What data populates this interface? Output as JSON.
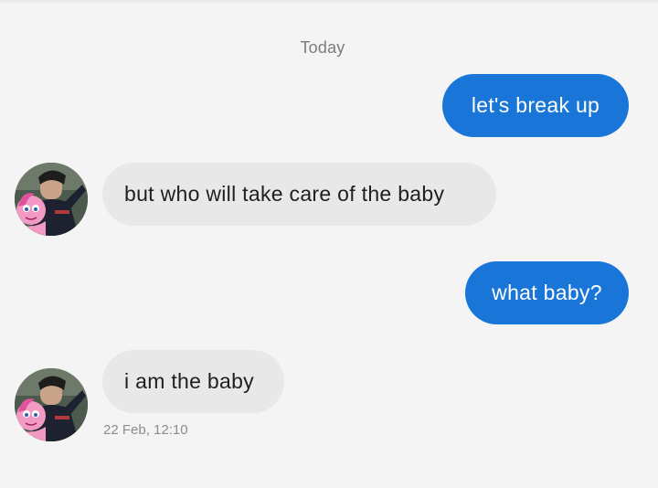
{
  "conversation": {
    "date_separator": "Today",
    "messages": [
      {
        "direction": "outgoing",
        "text": "let's break up"
      },
      {
        "direction": "incoming",
        "text": "but who will take care of the baby"
      },
      {
        "direction": "outgoing",
        "text": "what baby?"
      },
      {
        "direction": "incoming",
        "text": "i am the baby"
      }
    ],
    "last_timestamp": "22 Feb, 12:10"
  },
  "colors": {
    "background": "#f4f4f4",
    "outgoing_bubble": "#1976d8",
    "incoming_bubble": "#e8e8e8"
  },
  "icons": {
    "contact_avatar": "avatar-photo-with-pink-pony"
  }
}
